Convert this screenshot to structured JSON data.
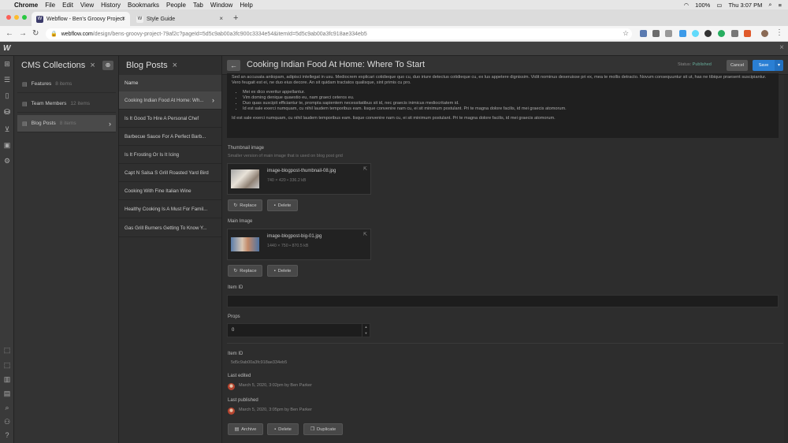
{
  "mac": {
    "apple": "",
    "menus": [
      "Chrome",
      "File",
      "Edit",
      "View",
      "History",
      "Bookmarks",
      "People",
      "Tab",
      "Window",
      "Help"
    ],
    "battery": "100%",
    "clock": "Thu 3:07 PM"
  },
  "tabs": [
    {
      "label": "Webflow - Ben's Groovy Project",
      "icon": "W"
    },
    {
      "label": "Style Guide",
      "icon": "W"
    }
  ],
  "address": {
    "domain": "webflow.com",
    "path": "/design/bens-groovy-project-79af2c?pageId=5d5c9ab00a3fc900c3334e54&itemId=5d5c9ab00a3fc918ae334eb5"
  },
  "wf": {
    "logo": "W"
  },
  "collections": {
    "title": "CMS Collections",
    "items": [
      {
        "label": "Features",
        "count": "8 items"
      },
      {
        "label": "Team Members",
        "count": "12 items"
      },
      {
        "label": "Blog Posts",
        "count": "8 items"
      }
    ]
  },
  "posts": {
    "title": "Blog Posts",
    "column": "Name",
    "items": [
      "Cooking Indian Food At Home: Wh...",
      "Is It Good To Hire A Personal Chef",
      "Barbecue Sauce For A Perfect Barb...",
      "Is It Frosting Or Is It Icing",
      "Capt N Salsa S Grill Roasted Yard Bird",
      "Cooking With Fine Italian Wine",
      "Healthy Cooking Is A Must For Famil...",
      "Gas Grill Burners Getting To Know Y..."
    ]
  },
  "editor": {
    "title": "Cooking Indian Food At Home: Where To Start",
    "status_label": "Status:",
    "status_value": "Published",
    "cancel": "Cancel",
    "save": "Save",
    "richtext": {
      "p1": "Sed an accusata antiopam, adipisci intellegat in usu. Mediocrem explicari cotidieque quo cu, duo iriure detectus cotidieque cu, ex lus appetere dignissim. Vidit nominus deseruisse pri ex, mea te mollis detracto. Novum consequuntur sit ut, has ne tibique praesent suscipiantur. Vero feugait est ei, ne duo eius decore. An sit quidam tractatos qualisque, sint primis cu pro.",
      "bullets": [
        "Mei ex dico everitur appellantur.",
        "Vim doming denique quaestio eu, nam graeci ceteros eu.",
        "Duo quas suscipit efficiantur te, prompta sapientem necessitatibus sit id, nec graecis inimicus mediocritatem id.",
        "Id est sale exerci numquam, cu nihil laudem temporibus eam. Iisque convenire nam cu, ei sit minimum postulant. Pri te magna dolore facilis, id mei graecis atomorum."
      ],
      "p2": "Id est sale exerci numquam, cu nihil laudem temporibus eam. Iisque convenire nam cu, ei sit minimum postulant. Pri te magna dolore facilis, id mei graecis atomorum."
    },
    "thumbnail": {
      "label": "Thumbnail image",
      "help": "Smaller version of main image that is used on blog post grid",
      "filename": "image-blogpost-thumbnail-08.jpg",
      "meta": "740 × 420 • 336.2 kB"
    },
    "main_image": {
      "label": "Main Image",
      "filename": "image-blogpost-big-01.jpg",
      "meta": "1440 × 750 • 870.5 kB"
    },
    "replace": "Replace",
    "delete": "Delete",
    "item_id_label": "Item ID",
    "props_label": "Props",
    "props_value": "0",
    "item_id_info_label": "Item ID",
    "item_id_value": "5d5c9ab00a3fc918ae334eb5",
    "last_edited_label": "Last edited",
    "last_edited_value": "March 5, 2020, 3:02pm by Ben Parker",
    "last_published_label": "Last published",
    "last_published_value": "March 5, 2020, 3:05pm by Ben Parker",
    "archive": "Archive",
    "delete2": "Delete",
    "duplicate": "Duplicate"
  }
}
